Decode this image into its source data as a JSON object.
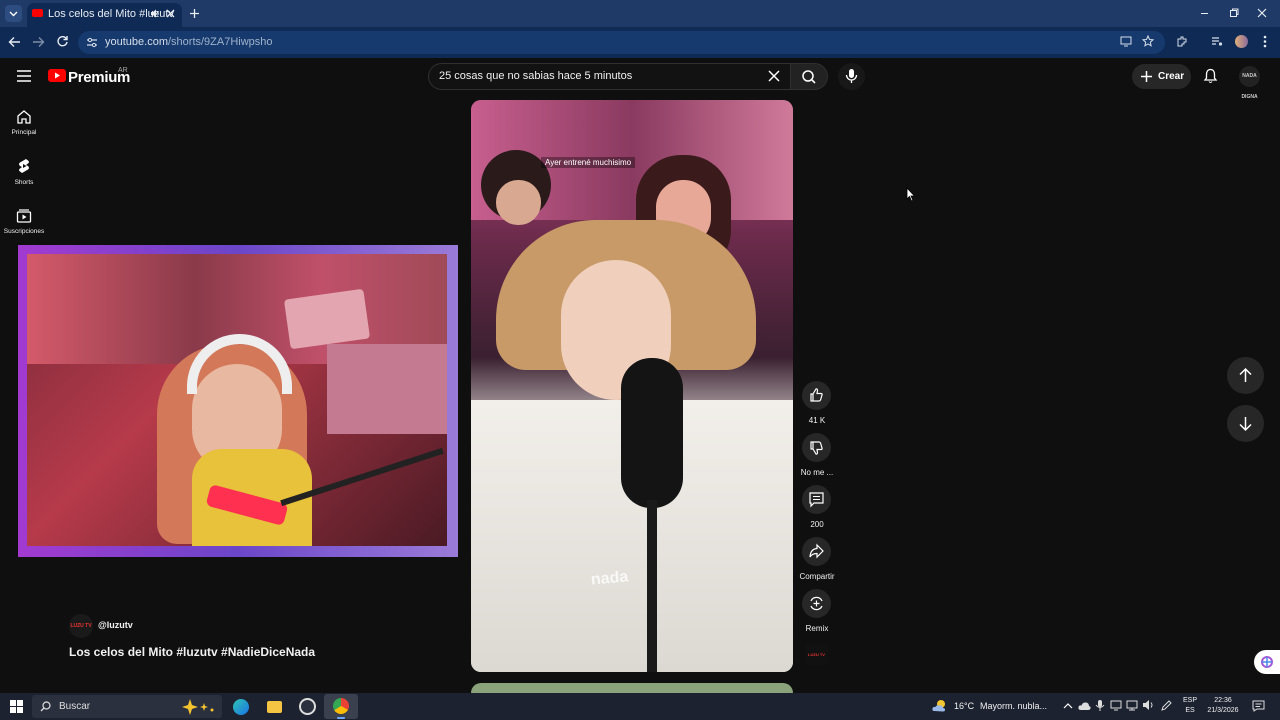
{
  "browser": {
    "tab_title": "Los celos del Mito #luzutv",
    "url_domain": "youtube.com",
    "url_path": "/shorts/9ZA7Hiwpsho"
  },
  "youtube": {
    "logo_text": "Premium",
    "region": "AR",
    "search_value": "25 cosas que no sabias hace 5 minutos",
    "create_label": "Crear",
    "avatar_text": "NADA DIGNA"
  },
  "sidebar": {
    "items": [
      {
        "label": "Principal",
        "icon": "home-icon"
      },
      {
        "label": "Shorts",
        "icon": "shorts-icon"
      },
      {
        "label": "Suscripciones",
        "icon": "subscriptions-icon"
      }
    ]
  },
  "video": {
    "caption": "Ayer entrené muchisimo",
    "watermark": "nada",
    "channel_handle": "@luzutv",
    "channel_avatar_text": "LUZU TV",
    "title": "Los celos del Mito #luzutv #NadieDiceNada"
  },
  "actions": {
    "likes": "41 K",
    "dislike_label": "No me ...",
    "comments": "200",
    "share_label": "Compartir",
    "remix_label": "Remix"
  },
  "taskbar": {
    "search_placeholder": "Buscar",
    "temperature": "16°C",
    "weather": "Mayorm. nubla...",
    "lang": "ESP",
    "lang_sub": "ES",
    "time": "22:36",
    "date": "21/3/2026"
  }
}
